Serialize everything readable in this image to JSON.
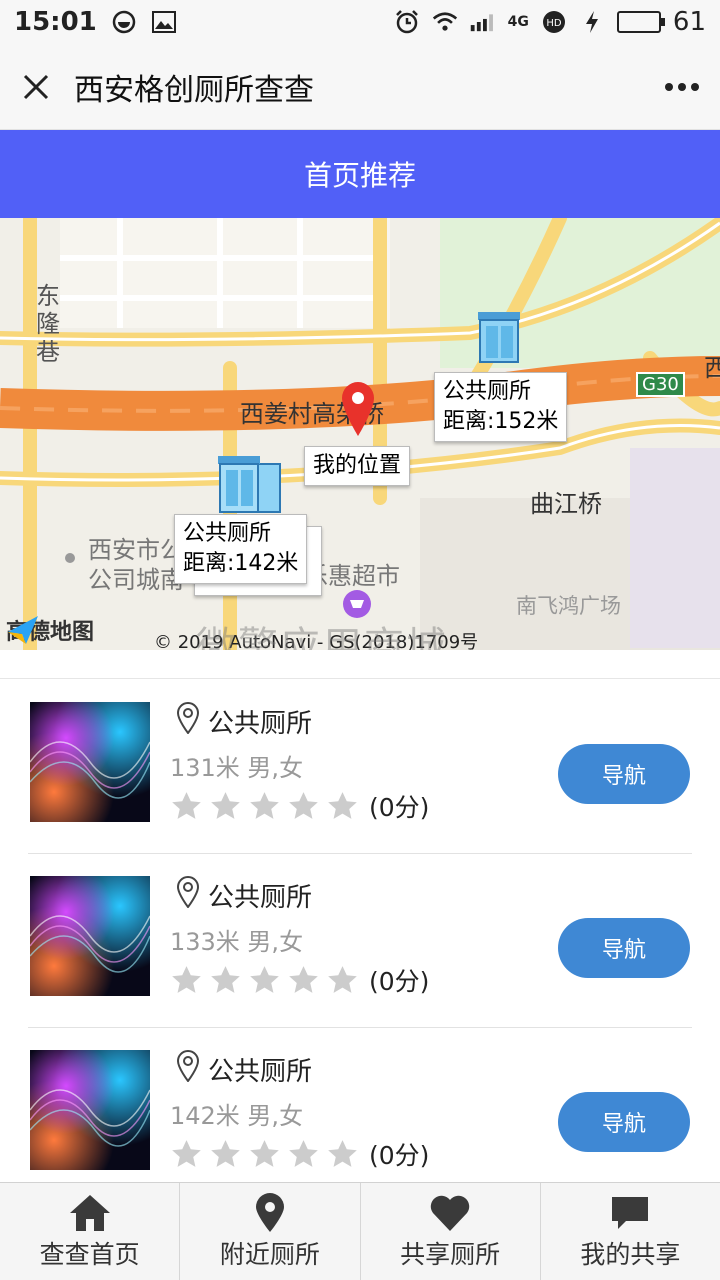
{
  "status_bar": {
    "time": "15:01",
    "network": "4G",
    "battery": "61",
    "battery_level": 0.61
  },
  "titlebar": {
    "title": "西安格创厕所查查",
    "close_icon": "close-icon",
    "more_icon": "more-icon"
  },
  "banner": {
    "label": "首页推荐"
  },
  "map": {
    "labels": {
      "street_1": "东",
      "street_2": "隆",
      "street_3": "巷",
      "overpass": "西姜村高架桥",
      "bridge": "曲江桥",
      "company_1": "西安市公",
      "company_2": "公司城南",
      "market": "乐惠超市",
      "plaza": "南飞鸿广场",
      "highway": "G30",
      "edge": "西"
    },
    "callouts": {
      "toilet_a_name": "公共厕所",
      "toilet_a_distance": "距离:152米",
      "my_location": "我的位置",
      "toilet_b_name": "公共厕所",
      "toilet_b_distance": "距离:142米"
    },
    "logo": "高德地图",
    "copyright": "© 2019 AutoNavi - GS(2018)1709号",
    "watermark": "微擎应用商城"
  },
  "toilets": [
    {
      "name": "公共厕所",
      "meta": "131米 男,女",
      "score": "(0分)",
      "rating": 0,
      "nav_label": "导航"
    },
    {
      "name": "公共厕所",
      "meta": "133米 男,女",
      "score": "(0分)",
      "rating": 0,
      "nav_label": "导航"
    },
    {
      "name": "公共厕所",
      "meta": "142米 男,女",
      "score": "(0分)",
      "rating": 0,
      "nav_label": "导航"
    }
  ],
  "tabs": [
    {
      "label": "查查首页",
      "icon": "home-icon"
    },
    {
      "label": "附近厕所",
      "icon": "location-pin-icon"
    },
    {
      "label": "共享厕所",
      "icon": "heart-icon"
    },
    {
      "label": "我的共享",
      "icon": "chat-icon"
    }
  ],
  "colors": {
    "banner": "#5160f7",
    "nav_button": "#3f88d4",
    "star_empty": "#cccccc",
    "marker": "#e8322b",
    "road_main": "#f08a3c",
    "road_secondary": "#f8d77a"
  }
}
